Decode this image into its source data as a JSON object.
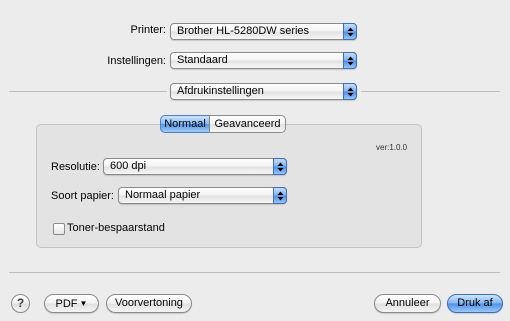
{
  "printer": {
    "label": "Printer:",
    "value": "Brother HL-5280DW series"
  },
  "presets": {
    "label": "Instellingen:",
    "value": "Standaard"
  },
  "panel": {
    "value": "Afdrukinstellingen"
  },
  "tabs": [
    {
      "label": "Normaal",
      "selected": true
    },
    {
      "label": "Geavanceerd",
      "selected": false
    }
  ],
  "version": "ver:1.0.0",
  "resolution": {
    "label": "Resolutie:",
    "value": "600 dpi"
  },
  "paper_type": {
    "label": "Soort papier:",
    "value": "Normaal papier"
  },
  "toner_save": {
    "label": "Toner-bespaarstand",
    "checked": false
  },
  "buttons": {
    "help": "?",
    "pdf": "PDF",
    "preview": "Voorvertoning",
    "cancel": "Annuleer",
    "print": "Druk af"
  },
  "colors": {
    "accent": "#5a96e8"
  }
}
